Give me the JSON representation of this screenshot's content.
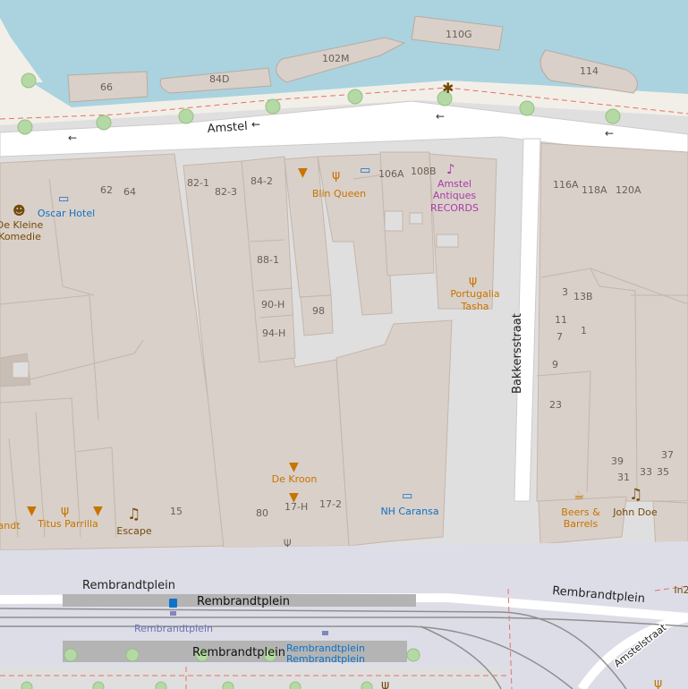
{
  "colors": {
    "water": "#aad3df",
    "land": "#e0dfdf",
    "building": "#d9d0c9",
    "building_stroke": "#c4b6ab",
    "pier": "#f2efe9",
    "road": "#ffffff",
    "tree": "#b5d9a4",
    "poi_orange": "#c77400",
    "poi_blue": "#0e72c8",
    "poi_purple": "#ac39ac",
    "tram": "#8f8f8f"
  },
  "streets": {
    "amstel": "Amstel",
    "bakkersstraat": "Bakkersstraat",
    "rembrandtplein_top": "Rembrandtplein",
    "rembrandtplein_right": "Rembrandtplein",
    "amstelstraat": "Amstelstraat"
  },
  "boats": {
    "b66": "66",
    "b84d": "84D",
    "b102m": "102M",
    "b110g": "110G",
    "b114": "114"
  },
  "pois": {
    "oscar_hotel": "Oscar Hotel",
    "de_kleine_1": "De Kleine",
    "de_kleine_2": "Komedie",
    "blin_queen": "Blin Queen",
    "amstel_antiques_1": "Amstel",
    "amstel_antiques_2": "Antiques",
    "amstel_antiques_3": "RECORDS",
    "portugalia_1": "Portugalia",
    "portugalia_2": "Tasha",
    "de_kroon": "De Kroon",
    "nh_caransa": "NH Caransa",
    "titus_parrilla": "Titus Parrilla",
    "escape": "Escape",
    "andt": "andt",
    "beers_barrels_1": "Beers &",
    "beers_barrels_2": "Barrels",
    "john_doe": "John Doe",
    "in2": "In2"
  },
  "house_numbers": {
    "n62": "62",
    "n64": "64",
    "n82_1": "82-1",
    "n82_3": "82-3",
    "n84_2": "84-2",
    "n106a": "106A",
    "n108b": "108B",
    "n88_1": "88-1",
    "n90_h": "90-H",
    "n94_h": "94-H",
    "n98": "98",
    "n116a": "116A",
    "n118a": "118A",
    "n120a": "120A",
    "n3": "3",
    "n13b": "13B",
    "n11": "11",
    "n7": "7",
    "n1": "1",
    "n9": "9",
    "n23": "23",
    "n37": "37",
    "n39": "39",
    "n31": "31",
    "n33": "33",
    "n35": "35",
    "n15": "15",
    "n80": "80",
    "n17_h": "17-H",
    "n17_2": "17-2"
  },
  "transit": {
    "platform_top": "Rembrandtplein",
    "stop_label": "Rembrandtplein",
    "platform_bottom": "Rembrandtplein",
    "stop_a": "Rembrandtplein",
    "stop_b": "Rembrandtplein"
  }
}
